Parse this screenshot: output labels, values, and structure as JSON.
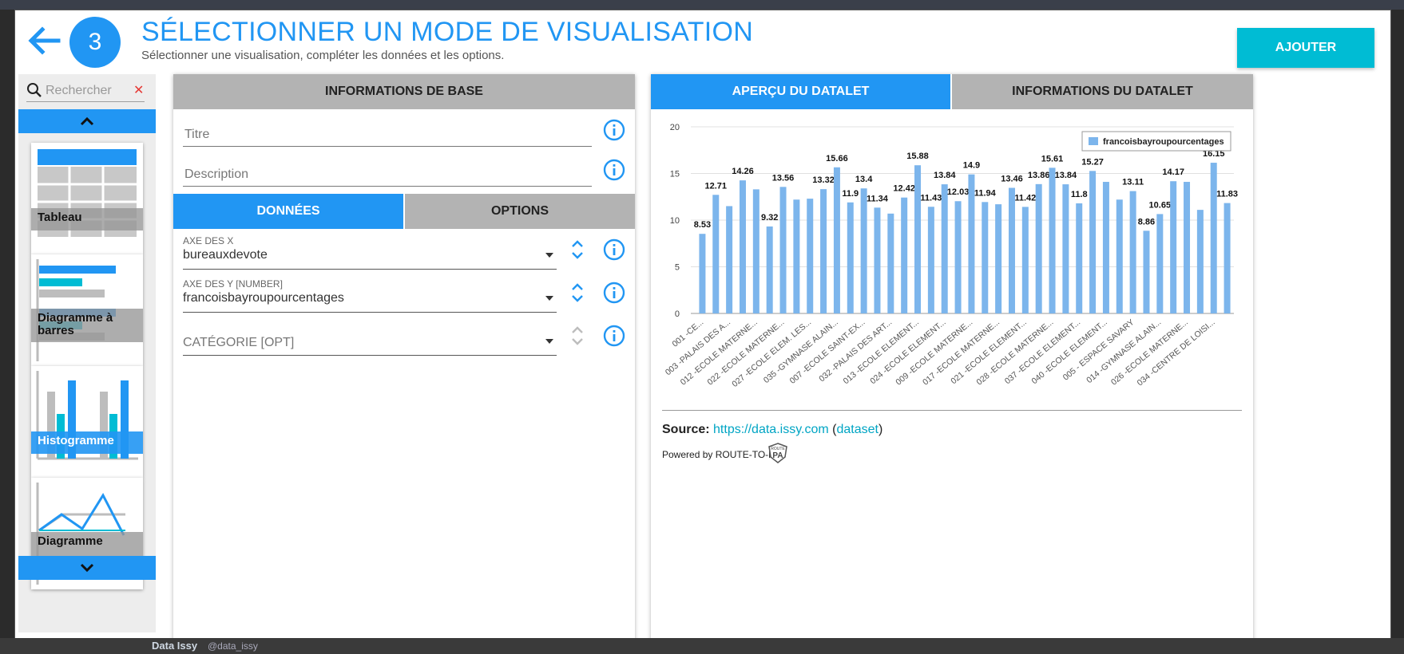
{
  "header": {
    "step_number": "3",
    "title": "SÉLECTIONNER UN MODE DE VISUALISATION",
    "subtitle": "Sélectionner une visualisation, compléter les données et les options.",
    "add_label": "AJOUTER"
  },
  "sidebar": {
    "search_placeholder": "Rechercher",
    "cards": [
      {
        "label": "Tableau",
        "active": false
      },
      {
        "label": "Diagramme à barres",
        "active": false
      },
      {
        "label": "Histogramme",
        "active": true
      },
      {
        "label": "Diagramme",
        "active": false
      }
    ]
  },
  "form": {
    "header": "INFORMATIONS DE BASE",
    "title_placeholder": "Titre",
    "description_placeholder": "Description",
    "tab_data": "DONNÉES",
    "tab_options": "OPTIONS",
    "x_axis_label": "AXE DES X",
    "x_axis_value": "bureauxdevote",
    "y_axis_label": "AXE DES Y [NUMBER]",
    "y_axis_value": "francoisbayroupourcentages",
    "category_placeholder": "CATÉGORIE [OPT]"
  },
  "preview": {
    "tab_preview": "APERÇU DU DATALET",
    "tab_info": "INFORMATIONS DU DATALET",
    "source_label": "Source:",
    "source_link": "https://data.issy.com",
    "dataset_link": "dataset",
    "powered_by": "Powered by ROUTE-TO-PA"
  },
  "chart_data": {
    "type": "bar",
    "series_name": "francoisbayroupourcentages",
    "ylim": [
      0,
      20
    ],
    "yticks": [
      0,
      5,
      10,
      15,
      20
    ],
    "grid": true,
    "legend_position": "top-right",
    "color": "#7cb5ec",
    "values": [
      8.53,
      12.71,
      11.5,
      14.26,
      13.3,
      9.32,
      13.56,
      12.2,
      12.3,
      13.32,
      15.66,
      11.9,
      13.4,
      11.34,
      10.7,
      12.42,
      15.88,
      11.43,
      13.84,
      12.03,
      14.9,
      11.94,
      11.7,
      13.46,
      11.42,
      13.86,
      15.61,
      13.84,
      11.8,
      15.27,
      14.1,
      12.2,
      13.11,
      8.86,
      10.65,
      14.17,
      14.1,
      11.1,
      16.15,
      11.83
    ],
    "labels": [
      "8.53",
      "12.71",
      "",
      "14.26",
      "",
      "9.32",
      "13.56",
      "",
      "",
      "13.32",
      "15.66",
      "11.9",
      "13.4",
      "11.34",
      "",
      "12.42",
      "15.88",
      "11.43",
      "13.84",
      "12.03",
      "14.9",
      "11.94",
      "",
      "13.46",
      "11.42",
      "13.86",
      "15.61",
      "13.84",
      "11.8",
      "15.27",
      "",
      "",
      "13.11",
      "8.86",
      "10.65",
      "14.17",
      "",
      "",
      "16.15",
      "11.83"
    ],
    "x_tick_labels": [
      "001 -CE...",
      "003 -PALAIS DES A...",
      "012 -ECOLE MATERNE...",
      "022 -ECOLE MATERNE...",
      "027 -ECOLE ELEM. LES...",
      "035 -GYMNASE ALAIN...",
      "007 -ECOLE SAINT-EX...",
      "032 -PALAIS DES ART...",
      "013 -ECOLE ELEMENT...",
      "024 -ECOLE ELEMENT...",
      "009 -ECOLE MATERNE...",
      "017 -ECOLE MATERNE...",
      "021 -ECOLE ELEMENT...",
      "028 -ECOLE MATERNE...",
      "037 -ECOLE ELEMENT...",
      "040 -ECOLE ELEMENT...",
      "005 - ESPACE SAVARY",
      "014 -GYMNASE ALAIN...",
      "026 -ECOLE MATERNE...",
      "034 -CENTRE DE LOISI..."
    ]
  }
}
